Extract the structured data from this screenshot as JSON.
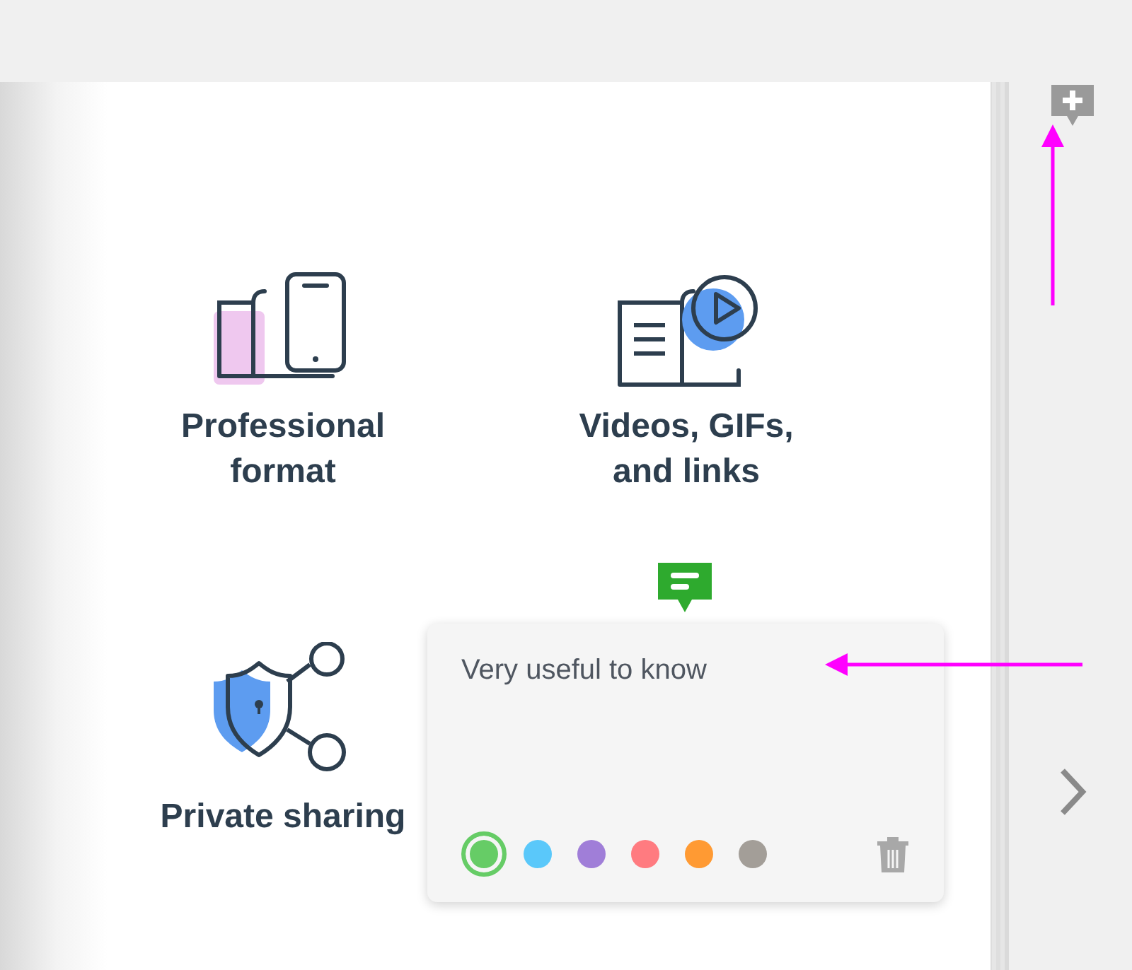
{
  "features": [
    {
      "kind": "devices",
      "title": "Professional format"
    },
    {
      "kind": "video",
      "title": "Videos, GIFs, and links"
    },
    {
      "kind": "sharing",
      "title": "Private sharing"
    }
  ],
  "note": {
    "text": "Very useful to know",
    "colors": [
      {
        "color": "#66cc66",
        "selected": true
      },
      {
        "color": "#5ac8fa",
        "selected": false
      },
      {
        "color": "#a07ed8",
        "selected": false
      },
      {
        "color": "#ff7b80",
        "selected": false
      },
      {
        "color": "#ff9a33",
        "selected": false
      },
      {
        "color": "#a39e98",
        "selected": false
      }
    ]
  }
}
